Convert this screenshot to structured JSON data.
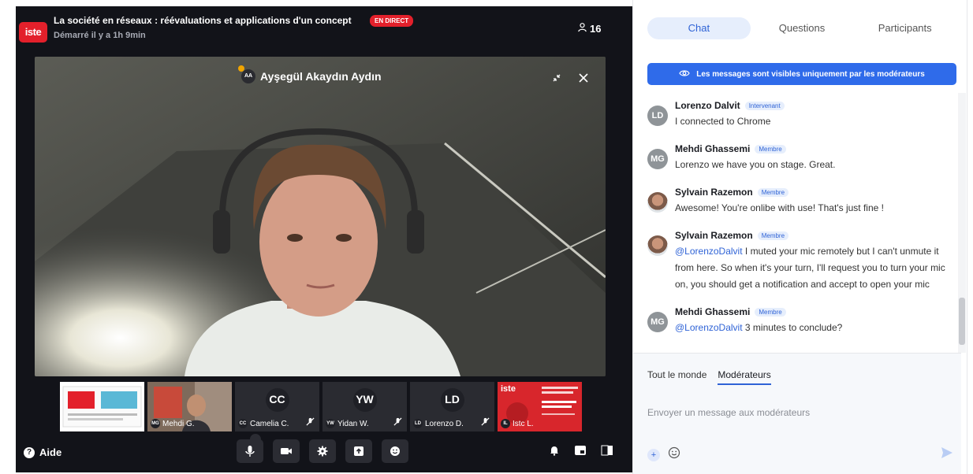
{
  "header": {
    "logo_text": "iste",
    "title": "La société en réseaux : réévaluations et applications d'un concept",
    "live_badge": "EN DIRECT",
    "started": "Démarré il y a 1h 9min",
    "viewer_count": "16"
  },
  "main_video": {
    "speaker_initials": "AA",
    "speaker_name": "Ayşegül Akaydın Aydın"
  },
  "thumbnails": [
    {
      "type": "slide"
    },
    {
      "type": "video",
      "initials": "MG",
      "name": "Mehdi G."
    },
    {
      "type": "avatar",
      "initials": "CC",
      "mini": "CC",
      "name": "Camelia C."
    },
    {
      "type": "avatar",
      "initials": "YW",
      "mini": "YW",
      "name": "Yidan W."
    },
    {
      "type": "avatar",
      "initials": "LD",
      "mini": "LD",
      "name": "Lorenzo D."
    },
    {
      "type": "slide-red",
      "logo_text": "iste",
      "mini": "IL",
      "name": "Istc L."
    }
  ],
  "bottom_bar": {
    "help_label": "Aide"
  },
  "panel": {
    "tabs": [
      "Chat",
      "Questions",
      "Participants"
    ],
    "active_tab": "Chat",
    "notice": "Les messages sont visibles uniquement par les modérateurs",
    "messages": [
      {
        "initials": "LD",
        "name": "Lorenzo Dalvit",
        "role": "Intervenant",
        "mention": "",
        "text": "I connected to Chrome",
        "photo": false
      },
      {
        "initials": "MG",
        "name": "Mehdi Ghassemi",
        "role": "Membre",
        "mention": "",
        "text": "Lorenzo we have you on stage. Great.",
        "photo": false
      },
      {
        "initials": "",
        "name": "Sylvain Razemon",
        "role": "Membre",
        "mention": "",
        "text": "Awesome! You're onlibe with use! That's just fine !",
        "photo": true
      },
      {
        "initials": "",
        "name": "Sylvain Razemon",
        "role": "Membre",
        "mention": "@LorenzoDalvit",
        "text": " I muted your mic remotely but I can't unmute it from here. So when it's your turn, I'll request you to turn your mic on, you should get a notification and accept to open your mic",
        "photo": true
      },
      {
        "initials": "MG",
        "name": "Mehdi Ghassemi",
        "role": "Membre",
        "mention": "@LorenzoDalvit",
        "text": " 3 minutes to conclude?",
        "photo": false
      }
    ],
    "audience_options": [
      "Tout le monde",
      "Modérateurs"
    ],
    "audience_selected": "Modérateurs",
    "composer_placeholder": "Envoyer un message aux modérateurs"
  },
  "colors": {
    "brand_red": "#e3202b",
    "accent_blue": "#2f6bea",
    "stage_bg": "#121319"
  }
}
